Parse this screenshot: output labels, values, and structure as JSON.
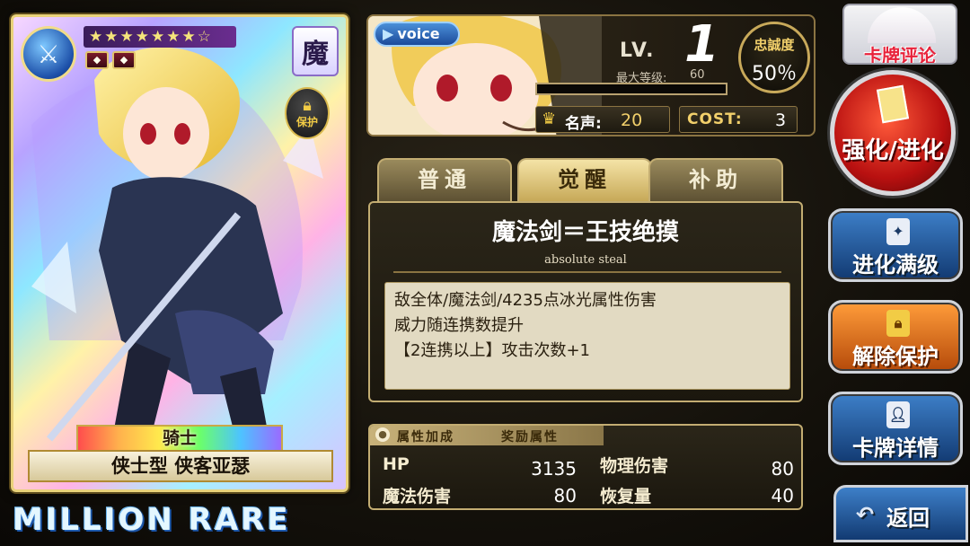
{
  "card": {
    "element_icon": "crossed-swords-icon",
    "stars": "★★★★★★★☆",
    "gems": [
      "◆",
      "◆"
    ],
    "attribute": "魔",
    "protect_label": "保护",
    "class": "骑士",
    "name": "侠士型 侠客亚瑟",
    "rarity": "MILLION RARE"
  },
  "status": {
    "voice_label": "voice",
    "level_label": "LV.",
    "level": "1",
    "max_level_label": "最大等级:",
    "max_level": "60",
    "exp_progress": 0.0,
    "loyalty_label": "忠誠度",
    "loyalty_value": "50％",
    "fame_label": "名声:",
    "fame_value": "20",
    "cost_label": "COST:",
    "cost_value": "3"
  },
  "tabs": [
    {
      "label": "普通",
      "active": false
    },
    {
      "label": "觉醒",
      "active": true
    },
    {
      "label": "补助",
      "active": false
    }
  ],
  "skill": {
    "title": "魔法剑＝王技绝摸",
    "subtitle": "absolute steal",
    "description": [
      "敌全体/魔法剑/4235点冰光属性伤害",
      "威力随连携数提升",
      "【2连携以上】攻击次数+1"
    ]
  },
  "stats": {
    "header_left": "属性加成",
    "header_right": "奖励属性",
    "rows": [
      {
        "label": "HP",
        "value": "3135"
      },
      {
        "label": "魔法伤害",
        "value": "80"
      },
      {
        "label": "物理伤害",
        "value": "80"
      },
      {
        "label": "恢复量",
        "value": "40"
      }
    ]
  },
  "buttons": {
    "review": "卡牌评论",
    "enhance": "强化/进化",
    "evolve_max": "进化满级",
    "unlock": "解除保护",
    "details": "卡牌详情",
    "back": "返回"
  },
  "colors": {
    "gold_border": "#c3ad72",
    "accent_yellow": "#f2d06b",
    "enhance_red": "#b81010",
    "button_blue": "#123a72",
    "button_orange": "#b54a0a"
  }
}
